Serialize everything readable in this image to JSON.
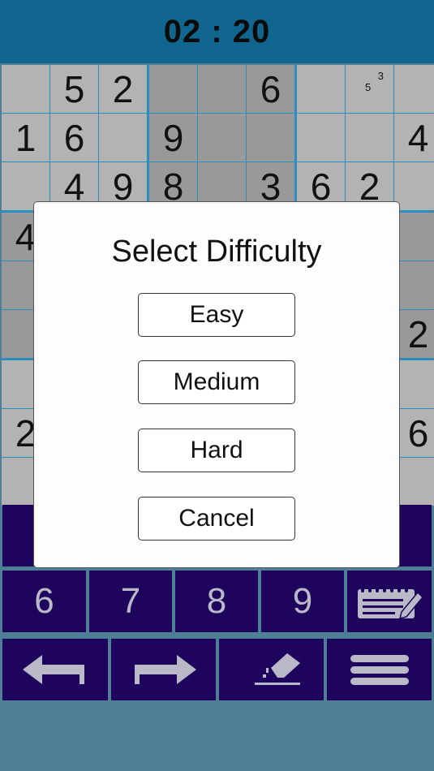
{
  "timer": "02 : 20",
  "colors": {
    "topbar": "#11668f",
    "cell_light": "#b3b3b3",
    "cell_dark": "#999999",
    "grid_line": "#2a8fbf",
    "keypad": "#1f045e",
    "background": "#4f7f95"
  },
  "board": {
    "visible_digits": [
      {
        "r": 0,
        "c": 1,
        "v": "5"
      },
      {
        "r": 0,
        "c": 2,
        "v": "2"
      },
      {
        "r": 0,
        "c": 5,
        "v": "6"
      },
      {
        "r": 1,
        "c": 0,
        "v": "1"
      },
      {
        "r": 1,
        "c": 1,
        "v": "6"
      },
      {
        "r": 1,
        "c": 3,
        "v": "9"
      },
      {
        "r": 1,
        "c": 8,
        "v": "4"
      },
      {
        "r": 2,
        "c": 1,
        "v": "4"
      },
      {
        "r": 2,
        "c": 2,
        "v": "9"
      },
      {
        "r": 2,
        "c": 3,
        "v": "8"
      },
      {
        "r": 2,
        "c": 5,
        "v": "3"
      },
      {
        "r": 2,
        "c": 6,
        "v": "6"
      },
      {
        "r": 2,
        "c": 7,
        "v": "2"
      },
      {
        "r": 3,
        "c": 0,
        "v": "4"
      },
      {
        "r": 5,
        "c": 8,
        "v": "2"
      },
      {
        "r": 7,
        "c": 0,
        "v": "2"
      },
      {
        "r": 7,
        "c": 8,
        "v": "6"
      }
    ],
    "notes": [
      {
        "r": 0,
        "c": 7,
        "v": "5",
        "pos": "mid-left"
      },
      {
        "r": 0,
        "c": 7,
        "v": "3",
        "pos": "top-right"
      }
    ]
  },
  "keypad": {
    "numbers": [
      "6",
      "7",
      "8",
      "9"
    ],
    "notes_icon": "notepad-pencil-icon",
    "undo_icon": "arrow-left-icon",
    "redo_icon": "arrow-right-icon",
    "erase_icon": "eraser-icon",
    "menu_icon": "menu-icon"
  },
  "dialog": {
    "title": "Select Difficulty",
    "easy": "Easy",
    "medium": "Medium",
    "hard": "Hard",
    "cancel": "Cancel"
  }
}
